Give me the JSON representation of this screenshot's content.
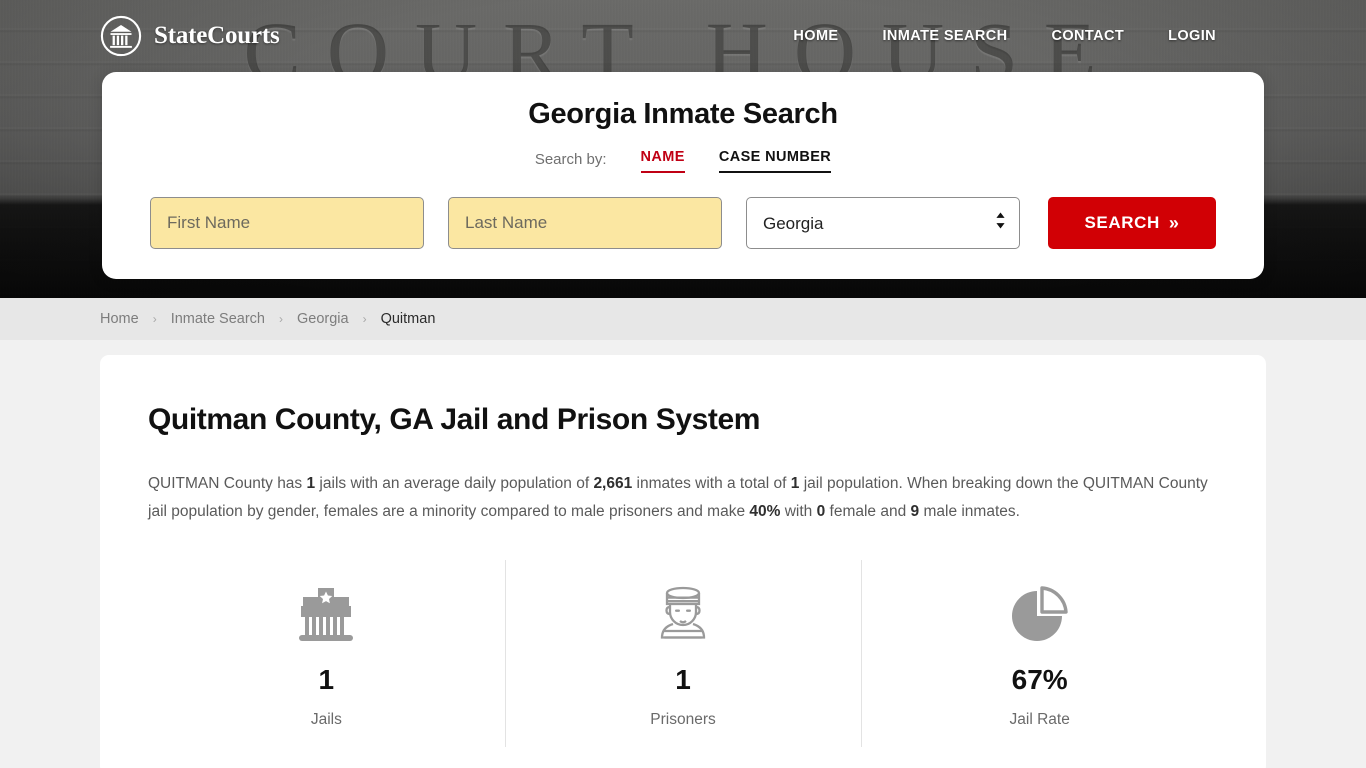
{
  "site": {
    "brand_name": "StateCourts",
    "logo_icon": "courthouse-circle-icon"
  },
  "nav": {
    "items": [
      {
        "label": "HOME"
      },
      {
        "label": "INMATE SEARCH"
      },
      {
        "label": "CONTACT"
      },
      {
        "label": "LOGIN"
      }
    ]
  },
  "search": {
    "title": "Georgia Inmate Search",
    "search_by_label": "Search by:",
    "tabs": [
      {
        "label": "NAME",
        "active": true,
        "color": "#c00014"
      },
      {
        "label": "CASE NUMBER",
        "active": false,
        "color": "#111111"
      }
    ],
    "first_name_placeholder": "First Name",
    "first_name_value": "",
    "last_name_placeholder": "Last Name",
    "last_name_value": "",
    "state_selected": "Georgia",
    "state_options": [
      "Georgia"
    ],
    "button_label": "SEARCH",
    "button_chevron": "»",
    "button_color": "#d10005",
    "field_autofill_color": "#fbe7a2"
  },
  "breadcrumb": {
    "separator": "›",
    "items": [
      {
        "label": "Home",
        "current": false
      },
      {
        "label": "Inmate Search",
        "current": false
      },
      {
        "label": "Georgia",
        "current": false
      },
      {
        "label": "Quitman",
        "current": true
      }
    ]
  },
  "main": {
    "page_title": "Quitman County, GA Jail and Prison System",
    "intro": {
      "segments": [
        {
          "text": "QUITMAN County has ",
          "bold": false
        },
        {
          "text": "1",
          "bold": true
        },
        {
          "text": " jails with an average daily population of ",
          "bold": false
        },
        {
          "text": "2,661",
          "bold": true
        },
        {
          "text": " inmates with a total of ",
          "bold": false
        },
        {
          "text": "1",
          "bold": true
        },
        {
          "text": " jail population. When breaking down the QUITMAN County jail population by gender, females are a minority compared to male prisoners and make ",
          "bold": false
        },
        {
          "text": "40%",
          "bold": true
        },
        {
          "text": " with ",
          "bold": false
        },
        {
          "text": "0",
          "bold": true
        },
        {
          "text": " female and ",
          "bold": false
        },
        {
          "text": "9",
          "bold": true
        },
        {
          "text": " male inmates.",
          "bold": false
        }
      ]
    },
    "stats": [
      {
        "icon": "jail-building-icon",
        "value": "1",
        "label": "Jails"
      },
      {
        "icon": "prisoner-icon",
        "value": "1",
        "label": "Prisoners"
      },
      {
        "icon": "pie-chart-icon",
        "value": "67%",
        "label": "Jail Rate"
      }
    ]
  }
}
